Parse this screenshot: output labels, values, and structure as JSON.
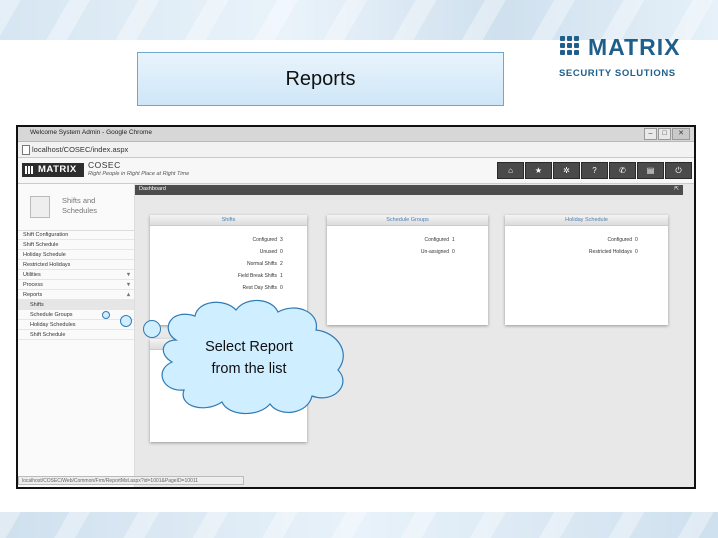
{
  "slide": {
    "title": "Reports",
    "logo": {
      "name": "MATRIX",
      "subtitle": "SECURITY SOLUTIONS",
      "brand_color": "#1f5f8b"
    },
    "callout": {
      "line1": "Select Report",
      "line2": "from the list"
    }
  },
  "browser": {
    "window_title": "Welcome System Admin - Google Chrome",
    "address": "localhost/COSEC/index.aspx",
    "status_url": "localhost/COSEC/Web/Common/Frm/ReportMst.aspx?id=1001&PageID=10011"
  },
  "app": {
    "logo_text": "MATRIX",
    "product": "COSEC",
    "tagline": "Right People in Right Place at Right Time",
    "toolbar_icons": [
      "home-icon",
      "star-icon",
      "gear-icon",
      "help-icon",
      "phone-icon",
      "monitor-icon",
      "power-icon"
    ],
    "toolbar_glyphs": [
      "⌂",
      "★",
      "✲",
      "?",
      "✆",
      "▤",
      "⏻"
    ],
    "sidebar": {
      "heading_line1": "Shifts and",
      "heading_line2": "Schedules",
      "items": [
        {
          "label": "Shift Configuration",
          "sub": false,
          "caret": ""
        },
        {
          "label": "Shift Schedule",
          "sub": false,
          "caret": ""
        },
        {
          "label": "Holiday Schedule",
          "sub": false,
          "caret": ""
        },
        {
          "label": "Restricted Holidays",
          "sub": false,
          "caret": ""
        },
        {
          "label": "Utilities",
          "sub": false,
          "caret": "▾"
        },
        {
          "label": "Process",
          "sub": false,
          "caret": "▾"
        },
        {
          "label": "Reports",
          "sub": false,
          "caret": "▴"
        },
        {
          "label": "Shifts",
          "sub": true,
          "caret": "",
          "selected": true
        },
        {
          "label": "Schedule Groups",
          "sub": true,
          "caret": ""
        },
        {
          "label": "Holiday Schedules",
          "sub": true,
          "caret": ""
        },
        {
          "label": "Shift Schedule",
          "sub": true,
          "caret": ""
        }
      ]
    },
    "dashboard": {
      "title": "Dashboard",
      "expand_glyph": "⇱",
      "cards": [
        {
          "title": "Shifts",
          "rows": [
            {
              "label": "Configured",
              "value": "3"
            },
            {
              "label": "Unused",
              "value": "0"
            },
            {
              "label": "Normal Shifts",
              "value": "2"
            },
            {
              "label": "Field Break Shifts",
              "value": "1"
            },
            {
              "label": "Rest Day Shifts",
              "value": "0"
            }
          ]
        },
        {
          "title": "Schedule Groups",
          "rows": [
            {
              "label": "Configured",
              "value": "1"
            },
            {
              "label": "Un-assigned",
              "value": "0"
            }
          ]
        },
        {
          "title": "Holiday Schedule",
          "rows": [
            {
              "label": "Configured",
              "value": "0"
            },
            {
              "label": "Restricted Holidays",
              "value": "0"
            }
          ]
        }
      ]
    }
  }
}
